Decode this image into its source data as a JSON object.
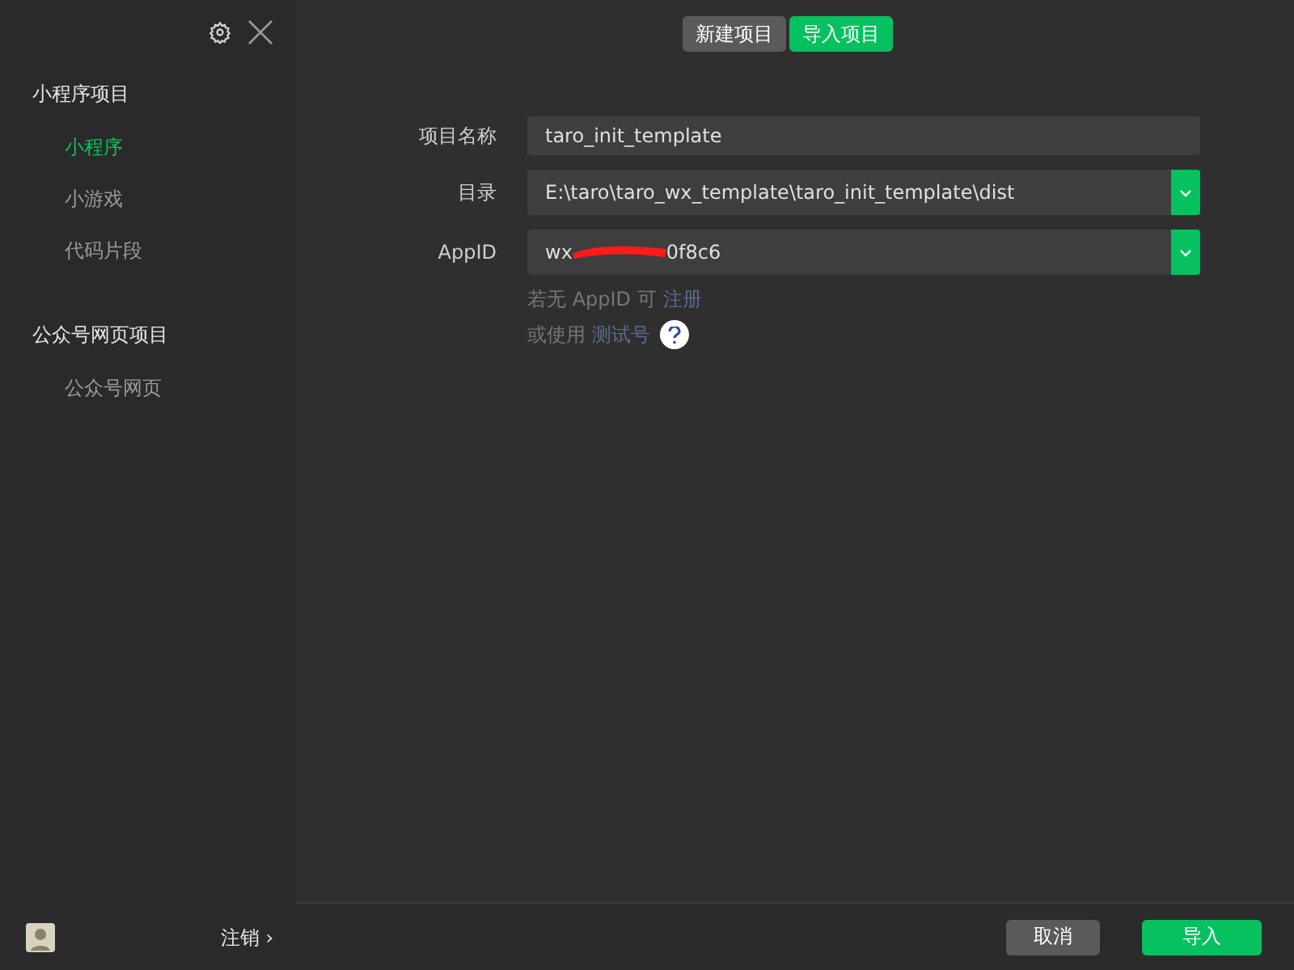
{
  "sidebar": {
    "sections": [
      {
        "title": "小程序项目",
        "items": [
          {
            "label": "小程序",
            "selected": true
          },
          {
            "label": "小游戏",
            "selected": false
          },
          {
            "label": "代码片段",
            "selected": false
          }
        ]
      },
      {
        "title": "公众号网页项目",
        "items": [
          {
            "label": "公众号网页",
            "selected": false
          }
        ]
      }
    ],
    "logout": {
      "label": "注销",
      "arrow": "›"
    }
  },
  "tabs": [
    {
      "label": "新建项目",
      "selected": false
    },
    {
      "label": "导入项目",
      "selected": true
    }
  ],
  "form": {
    "fields": [
      {
        "label": "项目名称",
        "kind": "text",
        "value": "taro_init_template"
      },
      {
        "label": "目录",
        "kind": "select",
        "value": "E:\\taro\\taro_wx_template\\taro_init_template\\dist"
      },
      {
        "label": "AppID",
        "kind": "redacted-select",
        "value_start": "wx",
        "value_end": "0f8c6"
      }
    ],
    "hints": [
      {
        "text": "若无 AppID 可",
        "link": "注册",
        "help": false
      },
      {
        "text": "或使用",
        "link": "测试号",
        "help": true
      }
    ]
  },
  "footer": {
    "buttons": [
      {
        "label": "取消",
        "kind": "secondary"
      },
      {
        "label": "导入",
        "kind": "primary"
      }
    ]
  }
}
